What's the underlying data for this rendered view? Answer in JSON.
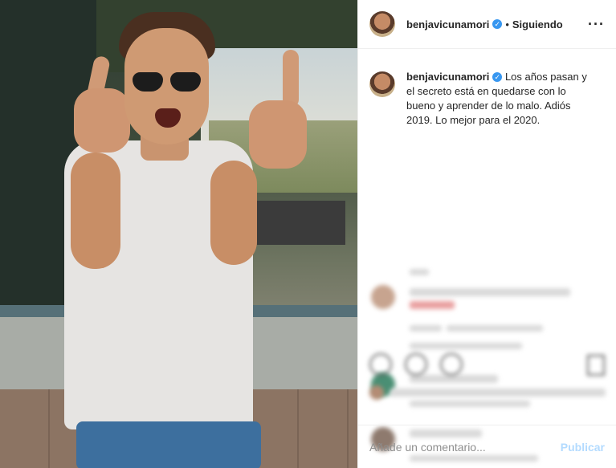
{
  "post": {
    "username": "benjavicunamori",
    "verified_glyph": "✓",
    "separator": "•",
    "follow_status": "Siguiendo",
    "more_glyph": "···",
    "caption": "Los años pasan y el secreto está en quedarse con lo bueno y aprender de lo malo. Adiós 2019. Lo mejor para el 2020."
  },
  "icons": {
    "more": "more-options-icon",
    "like": "heart-icon",
    "comment": "comment-icon",
    "share": "share-icon",
    "save": "bookmark-icon",
    "verified": "verified-badge-icon"
  },
  "comment_box": {
    "placeholder": "Añade un comentario...",
    "publish": "Publicar"
  },
  "colors": {
    "verified": "#3897f0",
    "publish": "#b3dbff",
    "text": "#262626"
  }
}
